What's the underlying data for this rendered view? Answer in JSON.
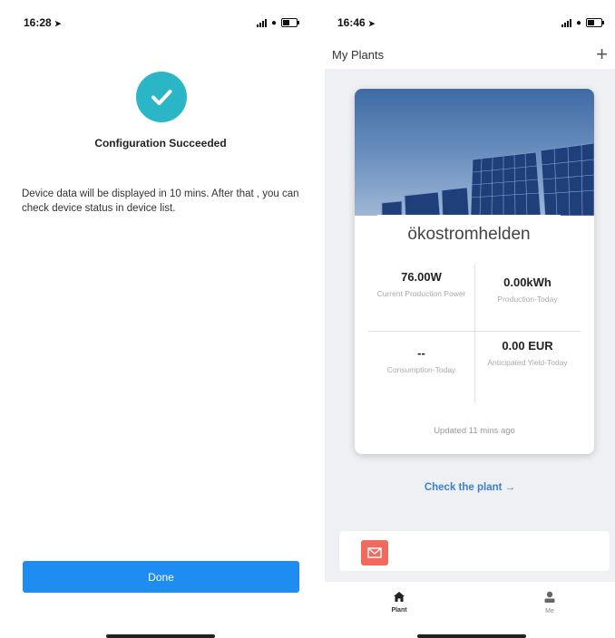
{
  "left_screen": {
    "status_time": "16:28",
    "success_title": "Configuration Succeeded",
    "message": "Device data will be displayed in 10 mins. After that , you can check device status in device list.",
    "done_label": "Done"
  },
  "right_screen": {
    "status_time": "16:46",
    "header_title": "My Plants",
    "add_icon": "+",
    "plant": {
      "name": "ökostromhelden",
      "current_power_value": "76.00W",
      "current_power_label": "Current Production Power",
      "production_today_value": "0.00kWh",
      "production_today_label": "Production-Today",
      "consumption_today_value": "--",
      "consumption_today_label": "Consumption-Today",
      "yield_today_value": "0.00 EUR",
      "yield_today_label": "Anticipated Yield-Today",
      "updated_text": "Updated 11 mins ago"
    },
    "check_plant_label": "Check the plant →",
    "tabs": [
      {
        "label": "Plant",
        "icon": "home-icon"
      },
      {
        "label": "Me",
        "icon": "user-icon"
      }
    ]
  },
  "colors": {
    "success_teal": "#2bb6c8",
    "done_blue": "#1e8cf0",
    "link_blue": "#3b7fd4",
    "mail_red": "#f06a5d"
  }
}
